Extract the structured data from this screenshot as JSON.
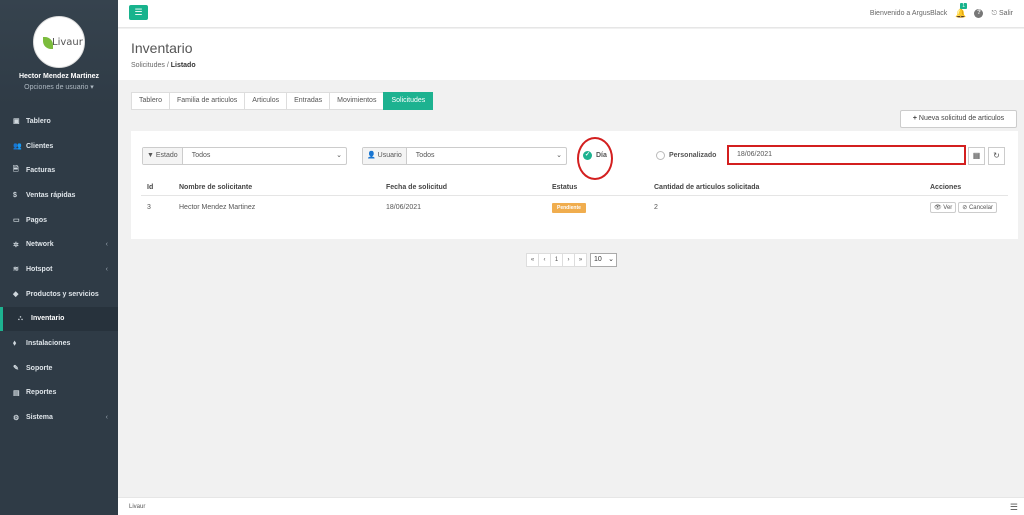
{
  "sidebar": {
    "logo_text": "Livaur",
    "user_name": "Hector Mendez Martinez",
    "user_options": "Opciones de usuario ▾",
    "items": [
      {
        "label": "Tablero",
        "icon": "▣",
        "chev": ""
      },
      {
        "label": "Clientes",
        "icon": "👥",
        "chev": ""
      },
      {
        "label": "Facturas",
        "icon": "🗎",
        "chev": ""
      },
      {
        "label": "Ventas rápidas",
        "icon": "$",
        "chev": ""
      },
      {
        "label": "Pagos",
        "icon": "▭",
        "chev": ""
      },
      {
        "label": "Network",
        "icon": "✲",
        "chev": "‹"
      },
      {
        "label": "Hotspot",
        "icon": "≋",
        "chev": "‹"
      },
      {
        "label": "Productos y servicios",
        "icon": "◆",
        "chev": ""
      },
      {
        "label": "Inventario",
        "icon": "⛬",
        "chev": ""
      },
      {
        "label": "Instalaciones",
        "icon": "⬧",
        "chev": ""
      },
      {
        "label": "Soporte",
        "icon": "✎",
        "chev": ""
      },
      {
        "label": "Reportes",
        "icon": "▤",
        "chev": ""
      },
      {
        "label": "Sistema",
        "icon": "⚙",
        "chev": "‹"
      }
    ]
  },
  "topbar": {
    "welcome": "Bienvenido a ArgusBlack",
    "notif_count": "1",
    "help": "?",
    "logout": "Salir"
  },
  "header": {
    "title": "Inventario",
    "crumb_parent": "Solicitudes",
    "crumb_sep": "/",
    "crumb_current": "Listado"
  },
  "tabs": [
    "Tablero",
    "Familia de articulos",
    "Articulos",
    "Entradas",
    "Movimientos",
    "Solicitudes"
  ],
  "new_button": "Nueva solicitud de articulos",
  "filters": {
    "estado_label": "Estado",
    "estado_value": "Todos",
    "usuario_label": "Usuario",
    "usuario_value": "Todos",
    "radio_dia": "Día",
    "radio_personalizado": "Personalizado",
    "date_value": "18/06/2021"
  },
  "table": {
    "columns": [
      "Id",
      "Nombre de solicitante",
      "Fecha de solicitud",
      "Estatus",
      "Cantidad de articulos solicitada",
      "Acciones"
    ],
    "rows": [
      {
        "id": "3",
        "name": "Hector Mendez Martinez",
        "date": "18/06/2021",
        "status": "Pendiente",
        "qty": "2",
        "ver": "Ver",
        "cancel": "Cancelar"
      }
    ]
  },
  "pager": {
    "first": "«",
    "prev": "‹",
    "page": "1",
    "next": "›",
    "last": "»",
    "size": "10"
  },
  "footer": {
    "brand": "Livaur"
  },
  "colors": {
    "accent": "#1db290",
    "sidebar": "#2f3b46",
    "highlight": "#d31f1f",
    "warning": "#f0ad4e"
  }
}
